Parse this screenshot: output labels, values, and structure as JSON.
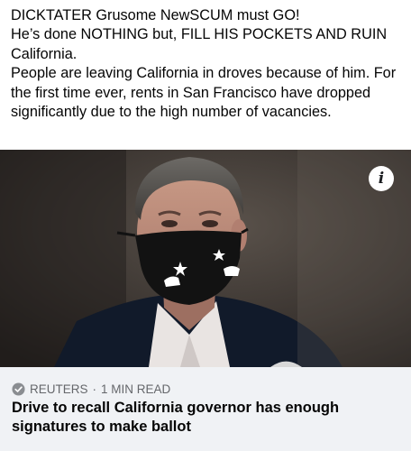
{
  "post": {
    "line1": "DICKTATER Grusome NewSCUM must GO!",
    "line2": "He’s done NOTHING but, FILL HIS POCKETS AND RUIN California.",
    "line3": "People are leaving California in droves because of him. For the first time ever, rents in San Francisco have dropped significantly due to the high number of vacancies."
  },
  "image": {
    "info_icon": "info-icon"
  },
  "link_card": {
    "source": "REUTERS",
    "separator": "·",
    "read_time": "1 MIN READ",
    "headline": "Drive to recall California governor has enough signatures to make ballot",
    "source_icon": "verified-check-icon"
  }
}
